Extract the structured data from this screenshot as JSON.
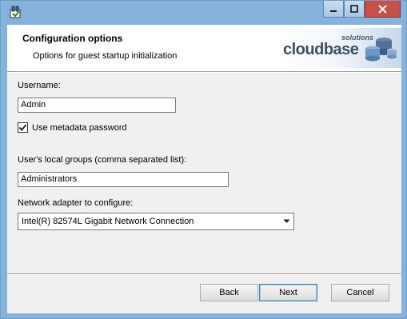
{
  "window": {
    "accent": "#85b3db",
    "icon": "installer-icon",
    "caption_buttons": {
      "minimize": "minimize-icon",
      "maximize": "maximize-icon",
      "close": "close-icon"
    }
  },
  "header": {
    "title": "Configuration options",
    "subtitle": "Options for guest startup initialization",
    "logo": {
      "word": "cloudbase",
      "small": "solutions"
    }
  },
  "form": {
    "username": {
      "label": "Username:",
      "value": "Admin"
    },
    "metadata_password": {
      "label": "Use metadata password",
      "checked": true
    },
    "groups": {
      "label": "User's local groups (comma separated list):",
      "value": "Administrators"
    },
    "network": {
      "label": "Network adapter to configure:",
      "selected": "Intel(R) 82574L Gigabit Network Connection"
    }
  },
  "buttons": {
    "back": "Back",
    "next": "Next",
    "cancel": "Cancel"
  }
}
